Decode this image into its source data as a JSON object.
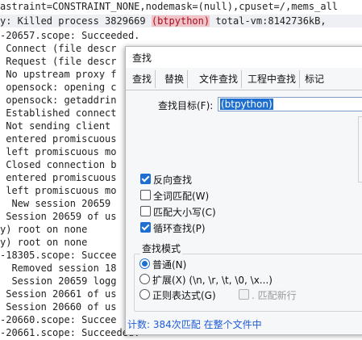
{
  "log": {
    "lines": [
      {
        "pre": "astraint=CONSTRAINT_NONE,nodemask=(null),cpuset=/,mems_all",
        "hl": "",
        "post": ""
      },
      {
        "pre": "y: Killed process 3829669 ",
        "hl": "(btpython)",
        "post": " total-vm:8142736kB,"
      },
      {
        "pre": "-20657.scope: Succeeded.",
        "hl": "",
        "post": ""
      },
      {
        "pre": " Connect (file descr",
        "hl": "",
        "post": ""
      },
      {
        "pre": " Request (file descr",
        "hl": "",
        "post": ""
      },
      {
        "pre": " No upstream proxy f",
        "hl": "",
        "post": ""
      },
      {
        "pre": " opensock: opening c",
        "hl": "",
        "post": ""
      },
      {
        "pre": " opensock: getaddrin",
        "hl": "",
        "post": ""
      },
      {
        "pre": " Established connect",
        "hl": "",
        "post": ""
      },
      {
        "pre": " Not sending client ",
        "hl": "",
        "post": ""
      },
      {
        "pre": " entered promiscuous",
        "hl": "",
        "post": ""
      },
      {
        "pre": " left promiscuous mo",
        "hl": "",
        "post": ""
      },
      {
        "pre": " Closed connection b",
        "hl": "",
        "post": ""
      },
      {
        "pre": " entered promiscuous",
        "hl": "",
        "post": ""
      },
      {
        "pre": " left promiscuous mo",
        "hl": "",
        "post": ""
      },
      {
        "pre": "  New session 20659 ",
        "hl": "",
        "post": ""
      },
      {
        "pre": " Session 20659 of us",
        "hl": "",
        "post": ""
      },
      {
        "pre": "y) root on none",
        "hl": "",
        "post": ""
      },
      {
        "pre": "y) root on none",
        "hl": "",
        "post": ""
      },
      {
        "pre": "-18305.scope: Succee",
        "hl": "",
        "post": ""
      },
      {
        "pre": "  Removed session 18",
        "hl": "",
        "post": ""
      },
      {
        "pre": "  Session 20659 logg",
        "hl": "",
        "post": ""
      },
      {
        "pre": " Session 20661 of us",
        "hl": "",
        "post": ""
      },
      {
        "pre": " Session 20660 of us",
        "hl": "",
        "post": ""
      },
      {
        "pre": "-20660.scope: Succee",
        "hl": "",
        "post": ""
      },
      {
        "pre": "-20661.scope: Succeeded.",
        "hl": "",
        "post": ""
      }
    ]
  },
  "dialog": {
    "title": "查找",
    "tabs": [
      "查找",
      "替换",
      "文件查找",
      "工程中查找",
      "标记"
    ],
    "active_tab": "查找",
    "find_label": "查找目标(F):",
    "find_value": "(btpython)",
    "options": [
      {
        "label": "反向查找",
        "checked": true
      },
      {
        "label": "全词匹配(W)",
        "checked": false
      },
      {
        "label": "匹配大小写(C)",
        "checked": false
      },
      {
        "label": "循环查找(P)",
        "checked": true
      }
    ],
    "mode_title": "查找模式",
    "modes": [
      {
        "label": "普通(N)",
        "selected": true
      },
      {
        "label": "扩展(X) (\\n, \\r, \\t, \\0, \\x...)",
        "selected": false
      },
      {
        "label": "正则表达式(G)",
        "selected": false
      }
    ],
    "newline_option": ". 匹配新行",
    "status": "计数: 384次匹配 在整个文件中"
  },
  "colors": {
    "accent": "#1e6fd0",
    "status_text": "#1e5bd8",
    "highlight_bg": "#f0c3c8"
  }
}
